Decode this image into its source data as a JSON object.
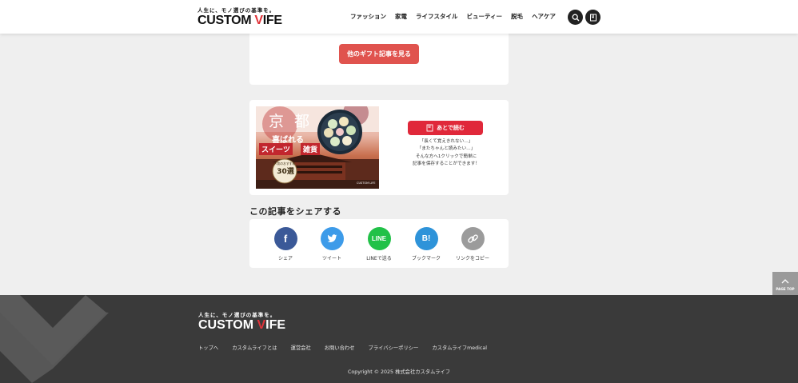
{
  "header": {
    "logo_tagline": "人生に、モノ選びの基準を。",
    "logo_word_a": "CUSTOM ",
    "logo_word_v": "V",
    "logo_word_b": "IFE",
    "nav": [
      "ファッション",
      "家電",
      "ライフスタイル",
      "ビューティー",
      "脱毛",
      "ヘアケア"
    ],
    "icons": [
      "search-icon",
      "bookmark-icon"
    ]
  },
  "gift_section": {
    "more_button": "他のギフト記事を見る"
  },
  "save_section": {
    "banner": {
      "kanji_1": "京",
      "kanji_small": "",
      "kanji_2": "都",
      "line1": "喜ばれる",
      "tag_1": "スイーツ",
      "tag_2": "雑貨",
      "badge_top": "人気のおすすめ",
      "badge_num": "30選",
      "brand": "CUSTOM LIFE"
    },
    "save_button": "あとで読む",
    "notes": [
      "「長くて覚えきれない…」",
      "「またちゃんと読みたい…」",
      "そんな方へ1クリックで簡単に",
      "記事を保存することができます！"
    ]
  },
  "share": {
    "title": "この記事をシェアする",
    "items": [
      {
        "label": "シェア",
        "icon": "facebook-icon",
        "color": "#3b5998",
        "glyph": "f"
      },
      {
        "label": "ツイート",
        "icon": "twitter-icon",
        "color": "#3d9be9",
        "glyph": ""
      },
      {
        "label": "LINEで送る",
        "icon": "line-icon",
        "color": "#21c148",
        "glyph": "LINE"
      },
      {
        "label": "ブックマーク",
        "icon": "hatena-bookmark-icon",
        "color": "#2e93d9",
        "glyph": "B!"
      },
      {
        "label": "リンクをコピー",
        "icon": "link-icon",
        "color": "#9b9b9b",
        "glyph": ""
      }
    ]
  },
  "page_top": {
    "label": "PAGE TOP"
  },
  "footer": {
    "logo_tagline": "人生に、モノ選びの基準を。",
    "links": [
      "トップへ",
      "カスタムライフとは",
      "運営会社",
      "お問い合わせ",
      "プライバシーポリシー",
      "カスタムライフmedical"
    ],
    "copyright": "Copyright © 2025 株式会社カスタムライフ"
  },
  "colors": {
    "accent_red": "#e0534e",
    "footer_bg": "#3a3a3a",
    "page_bg": "#efefef"
  }
}
